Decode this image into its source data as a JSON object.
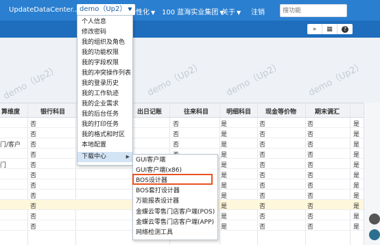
{
  "topbar": {
    "app_title": "UpdateDataCenter...",
    "user": "demo（Up2）",
    "personalize": "个性化",
    "org": "100  蓝海实业集团",
    "about": "关于",
    "logout": "注销",
    "search_placeholder": "搜功能"
  },
  "toolbar": {
    "collapse_label": "»",
    "grid_label": "▦",
    "help_label": "?"
  },
  "watermark": {
    "text": "demo（Up2）"
  },
  "table": {
    "headers": [
      "算维度",
      "银行科目",
      "出日记账",
      "往来科目",
      "明细科目",
      "现金等价物",
      "期末调汇"
    ],
    "rows": [
      {
        "c0": "",
        "c1": "否",
        "c3": "否",
        "c4": "是",
        "c5": "否",
        "c6": "否",
        "highlight": false
      },
      {
        "c0": "",
        "c1": "否",
        "c3": "否",
        "c4": "是",
        "c5": "否",
        "c6": "否",
        "highlight": false
      },
      {
        "c0": "门/客户",
        "c1": "否",
        "c3": "否",
        "c4": "是",
        "c5": "否",
        "c6": "否",
        "highlight": false
      },
      {
        "c0": "",
        "c1": "否",
        "c3": "否",
        "c4": "是",
        "c5": "否",
        "c6": "否",
        "highlight": false
      },
      {
        "c0": "门",
        "c1": "否",
        "c3": "否",
        "c4": "是",
        "c5": "否",
        "c6": "否",
        "highlight": false
      },
      {
        "c0": "",
        "c1": "否",
        "c3": "否",
        "c4": "是",
        "c5": "否",
        "c6": "否",
        "highlight": false
      },
      {
        "c0": "",
        "c1": "否",
        "c3": "否",
        "c4": "是",
        "c5": "否",
        "c6": "否",
        "highlight": false
      },
      {
        "c0": "",
        "c1": "否",
        "c3": "否",
        "c4": "是",
        "c5": "否",
        "c6": "否",
        "highlight": false
      },
      {
        "c0": "",
        "c1": "否",
        "c3": "否",
        "c4": "是",
        "c5": "否",
        "c6": "否",
        "highlight": true
      },
      {
        "c0": "",
        "c1": "否",
        "c3": "否",
        "c4": "是",
        "c5": "否",
        "c6": "否",
        "highlight": false
      },
      {
        "c0": "",
        "c1": "否",
        "c3": "否",
        "c4": "是",
        "c5": "否",
        "c6": "否",
        "highlight": false
      }
    ],
    "right_col_glyph": "是"
  },
  "user_menu": {
    "items": [
      "个人信息",
      "修改密码",
      "我的组织及角色",
      "我的功能权限",
      "我的字段权限",
      "我的冲突操作列表",
      "我的登录历史",
      "我的工作轨迹",
      "我的企业需求",
      "我的后台任务",
      "我的打印任务",
      "我的格式和时区",
      "本地配置",
      "下载中心"
    ],
    "submenu_arrow": "▶"
  },
  "download_menu": {
    "items": [
      "GUI客户端",
      "GUI客户端(x86)",
      "BOS设计器",
      "BOS套打设计器",
      "万能报表设计器",
      "金蝶云零售门店客户端(POS)",
      "金蝶云零售门店客户端(APP)",
      "网络检测工具"
    ]
  }
}
